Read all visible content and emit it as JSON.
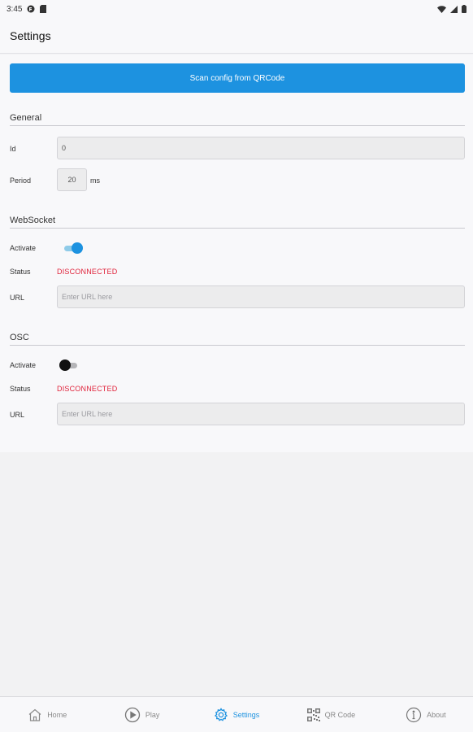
{
  "status_bar": {
    "time": "3:45"
  },
  "app_bar": {
    "title": "Settings"
  },
  "scan_button": {
    "label": "Scan config from QRCode"
  },
  "general": {
    "title": "General",
    "id_label": "Id",
    "id_value": "0",
    "period_label": "Period",
    "period_value": "20",
    "period_unit": "ms"
  },
  "websocket": {
    "title": "WebSocket",
    "activate_label": "Activate",
    "activate_state": "on",
    "status_label": "Status",
    "status_value": "DISCONNECTED",
    "url_label": "URL",
    "url_placeholder": "Enter URL here"
  },
  "osc": {
    "title": "OSC",
    "activate_label": "Activate",
    "activate_state": "off",
    "status_label": "Status",
    "status_value": "DISCONNECTED",
    "url_label": "URL",
    "url_placeholder": "Enter URL here"
  },
  "bottom_nav": {
    "items": [
      {
        "label": "Home",
        "icon": "home-icon"
      },
      {
        "label": "Play",
        "icon": "play-icon"
      },
      {
        "label": "Settings",
        "icon": "gear-icon",
        "active": true
      },
      {
        "label": "QR Code",
        "icon": "qr-code-icon"
      },
      {
        "label": "About",
        "icon": "info-icon"
      }
    ]
  },
  "colors": {
    "accent": "#1d92e0",
    "error": "#e0223a"
  }
}
